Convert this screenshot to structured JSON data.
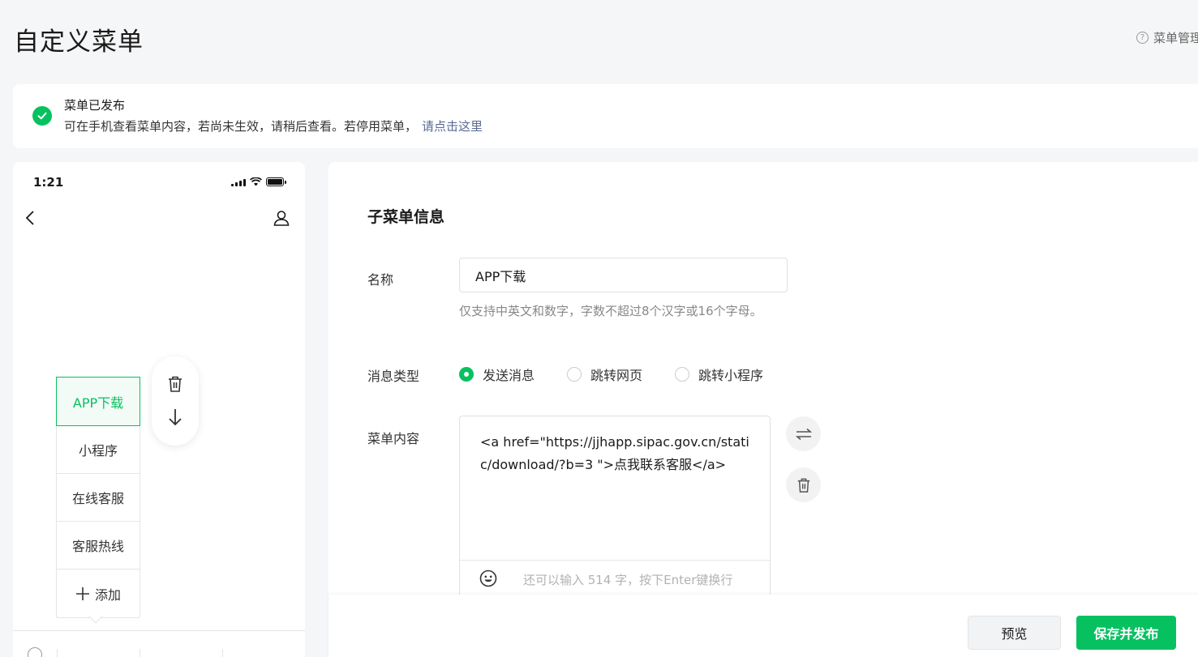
{
  "header": {
    "title": "自定义菜单",
    "help_label": "菜单管理",
    "help_icon": "question-circle-icon"
  },
  "notice": {
    "title": "菜单已发布",
    "desc": "可在手机查看菜单内容，若尚未生效，请稍后查看。若停用菜单，",
    "link": "请点击这里",
    "status_color": "#07c160"
  },
  "phone": {
    "time": "1:21",
    "submenu": [
      {
        "label": "APP下载",
        "active": true
      },
      {
        "label": "小程序",
        "active": false
      },
      {
        "label": "在线客服",
        "active": false
      },
      {
        "label": "客服热线",
        "active": false
      }
    ],
    "add_label": "添加"
  },
  "panel": {
    "section_title": "子菜单信息",
    "name_label": "名称",
    "name_value": "APP下载",
    "name_hint": "仅支持中英文和数字，字数不超过8个汉字或16个字母。",
    "type_label": "消息类型",
    "type_options": [
      "发送消息",
      "跳转网页",
      "跳转小程序"
    ],
    "type_selected": "发送消息",
    "content_label": "菜单内容",
    "content_value": "<a href=\"https://jjhapp.sipac.gov.cn/static/download/?b=3 \">点我联系客服</a>",
    "content_remaining": "还可以输入 514 字，按下Enter键换行"
  },
  "footer": {
    "preview_label": "预览",
    "save_label": "保存并发布"
  },
  "colors": {
    "accent": "#07c160",
    "link": "#576b95"
  }
}
